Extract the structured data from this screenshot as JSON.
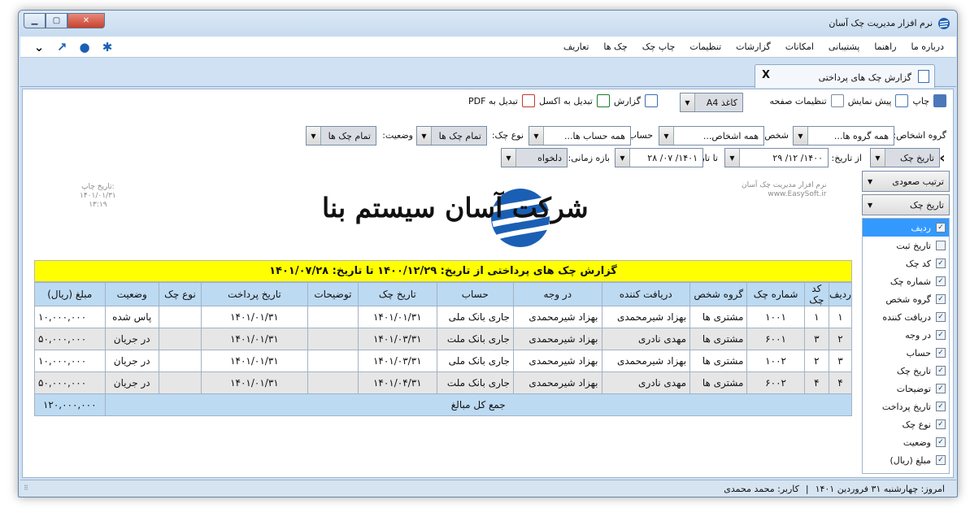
{
  "window": {
    "title": "نرم افزار مدیریت چک آسان"
  },
  "menu": [
    "تعاریف",
    "چک ها",
    "چاپ چک",
    "تنظیمات",
    "گزارشات",
    "امکانات",
    "پشتیبانی",
    "راهنما",
    "درباره ما"
  ],
  "menu_icons": [
    "gear-icon",
    "user-icon",
    "arrow-icon",
    "chevron-down-icon"
  ],
  "tab": {
    "label": "گزارش چک های پرداختی",
    "close": "X"
  },
  "toolbar": {
    "print": "چاپ",
    "preview": "پیش نمایش",
    "page_settings": "تنظیمات صفحه",
    "paper": "کاغذ A4",
    "report": "گزارش",
    "excel": "تبدیل به اکسل",
    "pdf": "تبدیل به PDF"
  },
  "filters": {
    "person_group_label": "گروه اشخاص:",
    "person_group_value": "همه گروه ها...",
    "person_label": "شخص:",
    "person_value": "همه اشخاص...",
    "account_label": "حساب:",
    "account_value": "همه حساب ها...",
    "check_type_label": "نوع چک:",
    "check_type_value": "تمام چک ها",
    "status_label": "وضعیت:",
    "status_value": "تمام چک ها"
  },
  "daterow": {
    "date_field": "تاریخ چک",
    "from_label": "از تاریخ:",
    "from_value": "۱۴۰۰/ ۱۲/ ۲۹",
    "to_label": "تا تاریخ:",
    "to_value": "۱۴۰۱/ ۰۷/ ۲۸",
    "range_label": "بازه زمانی:",
    "range_value": "دلخواه"
  },
  "side": {
    "sort_order": "ترتیب صعودی",
    "sort_field": "تاریخ چک",
    "columns": [
      {
        "label": "ردیف",
        "checked": true,
        "selected": true
      },
      {
        "label": "تاریخ ثبت",
        "checked": false,
        "selected": false
      },
      {
        "label": "کد چک",
        "checked": true,
        "selected": false
      },
      {
        "label": "شماره چک",
        "checked": true,
        "selected": false
      },
      {
        "label": "گروه شخص",
        "checked": true,
        "selected": false
      },
      {
        "label": "دریافت کننده",
        "checked": true,
        "selected": false
      },
      {
        "label": "در وجه",
        "checked": true,
        "selected": false
      },
      {
        "label": "حساب",
        "checked": true,
        "selected": false
      },
      {
        "label": "تاریخ چک",
        "checked": true,
        "selected": false
      },
      {
        "label": "توضیحات",
        "checked": true,
        "selected": false
      },
      {
        "label": "تاریخ پرداخت",
        "checked": true,
        "selected": false
      },
      {
        "label": "نوع چک",
        "checked": true,
        "selected": false
      },
      {
        "label": "وضعیت",
        "checked": true,
        "selected": false
      },
      {
        "label": "مبلغ (ریال)",
        "checked": true,
        "selected": false
      }
    ]
  },
  "report": {
    "print_date_label": "تاریخ چاپ:",
    "print_date": "۱۴۰۱/۰۱/۳۱",
    "print_time": "۱۳:۱۹",
    "software_name": "نرم افزار مدیریت چک آسان",
    "website": "www.EasySoft.ir",
    "company": "شرکت آسان سیستم بنا",
    "title": "گزارش چک های پرداختی از تاریخ: ۱۴۰۰/۱۲/۲۹ تا تاریخ: ۱۴۰۱/۰۷/۲۸",
    "headers": [
      "ردیف",
      "کد چک",
      "شماره چک",
      "گروه شخص",
      "دریافت کننده",
      "در وجه",
      "حساب",
      "تاریخ چک",
      "توضیحات",
      "تاریخ پرداخت",
      "نوع چک",
      "وضعیت",
      "مبلغ (ریال)"
    ],
    "rows": [
      [
        "۱",
        "۱",
        "۱۰۰۱",
        "مشتری ها",
        "بهزاد شیرمحمدی",
        "بهزاد شیرمحمدی",
        "جاری بانک ملی",
        "۱۴۰۱/۰۱/۳۱",
        "",
        "۱۴۰۱/۰۱/۳۱",
        "",
        "پاس شده",
        "۱۰,۰۰۰,۰۰۰"
      ],
      [
        "۲",
        "۳",
        "۶۰۰۱",
        "مشتری ها",
        "مهدی نادری",
        "بهزاد شیرمحمدی",
        "جاری بانک ملت",
        "۱۴۰۱/۰۳/۳۱",
        "",
        "۱۴۰۱/۰۱/۳۱",
        "",
        "در جریان",
        "۵۰,۰۰۰,۰۰۰"
      ],
      [
        "۳",
        "۲",
        "۱۰۰۲",
        "مشتری ها",
        "بهزاد شیرمحمدی",
        "بهزاد شیرمحمدی",
        "جاری بانک ملی",
        "۱۴۰۱/۰۳/۳۱",
        "",
        "۱۴۰۱/۰۱/۳۱",
        "",
        "در جریان",
        "۱۰,۰۰۰,۰۰۰"
      ],
      [
        "۴",
        "۴",
        "۶۰۰۲",
        "مشتری ها",
        "مهدی نادری",
        "بهزاد شیرمحمدی",
        "جاری بانک ملت",
        "۱۴۰۱/۰۴/۳۱",
        "",
        "۱۴۰۱/۰۱/۳۱",
        "",
        "در جریان",
        "۵۰,۰۰۰,۰۰۰"
      ]
    ],
    "total_label": "جمع کل مبالغ",
    "total_value": "۱۲۰,۰۰۰,۰۰۰"
  },
  "status": {
    "today": "امروز: چهارشنبه ۳۱ فروردین ۱۴۰۱",
    "separator": "|",
    "user": "کاربر: محمد محمدی"
  },
  "colors": {
    "title_bg": "#ffff00",
    "header_bg": "#bcdaf2",
    "selected": "#3399ff"
  }
}
